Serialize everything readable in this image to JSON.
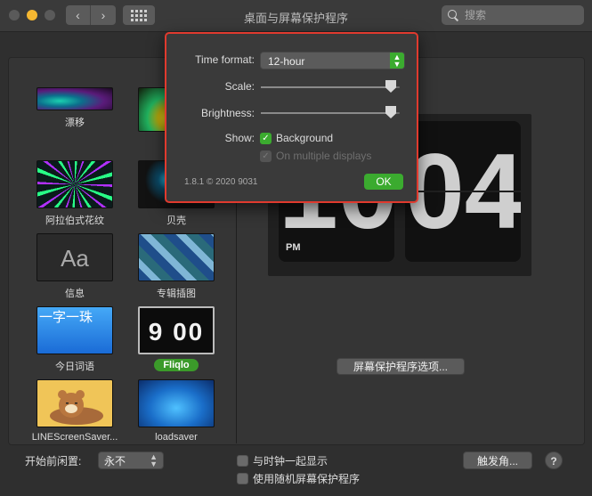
{
  "window": {
    "title": "桌面与屏幕保护程序",
    "search_placeholder": "搜索",
    "back_glyph": "‹",
    "forward_glyph": "›"
  },
  "screensavers": [
    {
      "label": "漂移",
      "selected": false
    },
    {
      "label": "",
      "selected": false
    },
    {
      "label": "阿拉伯式花纹",
      "selected": false
    },
    {
      "label": "贝壳",
      "selected": false
    },
    {
      "label": "信息",
      "selected": false,
      "thumb_text": "Aa"
    },
    {
      "label": "专辑插图",
      "selected": false
    },
    {
      "label": "今日词语",
      "selected": false,
      "thumb_text": "一字一珠"
    },
    {
      "label": "Fliqlo",
      "selected": true,
      "thumb_text": "9 00"
    },
    {
      "label": "LINEScreenSaver...",
      "selected": false
    },
    {
      "label": "loadsaver",
      "selected": false
    }
  ],
  "preview": {
    "hour": "10",
    "minute": "04",
    "period": "PM"
  },
  "options_button": "屏幕保护程序选项...",
  "bottom": {
    "idle_label": "开始前闲置:",
    "idle_value": "永不",
    "show_clock_label": "与时钟一起显示",
    "random_label": "使用随机屏幕保护程序",
    "hot_corners": "触发角...",
    "help": "?"
  },
  "dialog": {
    "time_format_label": "Time format:",
    "time_format_value": "12-hour",
    "scale_label": "Scale:",
    "scale_value": 0.97,
    "brightness_label": "Brightness:",
    "brightness_value": 0.97,
    "show_label": "Show:",
    "background_label": "Background",
    "background_checked": true,
    "multiple_displays_label": "On multiple displays",
    "multiple_displays_checked": true,
    "multiple_displays_enabled": false,
    "version": "1.8.1 © 2020 9031",
    "ok": "OK"
  },
  "colors": {
    "accent_green": "#3bab2f",
    "highlight_red": "#e03a2e",
    "minimize_yellow": "#f5b731"
  }
}
